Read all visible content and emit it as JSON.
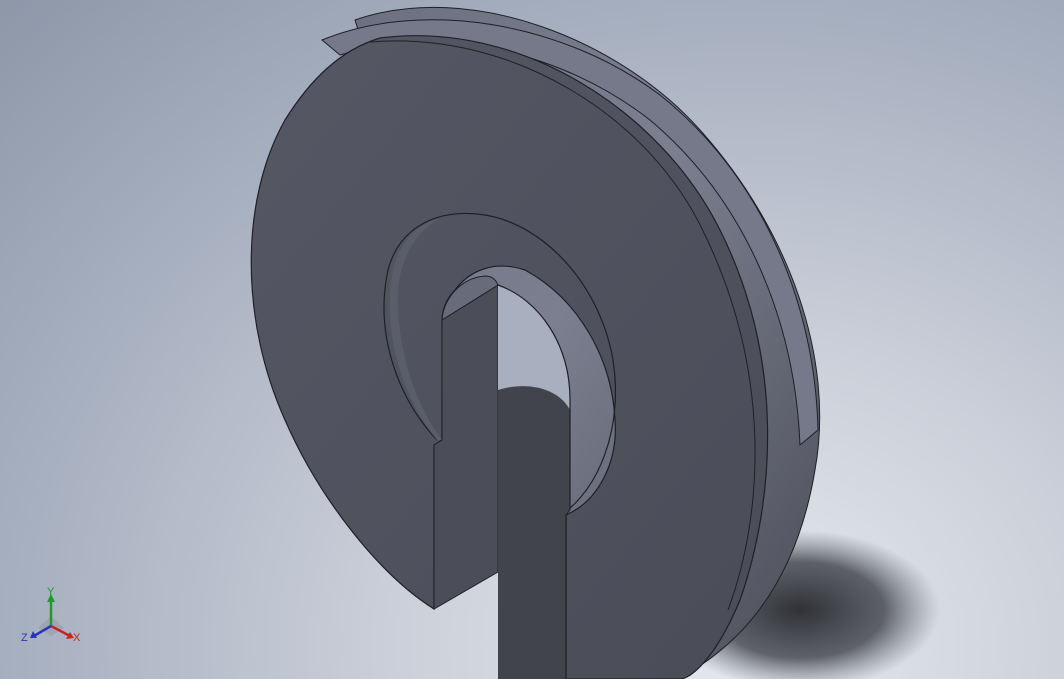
{
  "viewport": {
    "background_top": "#8d97a8",
    "background_bottom": "#e6e9ef",
    "model_face_color": "#4e505c",
    "model_rim_color": "#727585",
    "model_edge_color": "#1e2026",
    "shadow_color": "#2b2d33"
  },
  "triad": {
    "y_label": "Y",
    "x_label": "X",
    "z_label": "Z",
    "y_color": "#1e9a2a",
    "x_color": "#cc2222",
    "z_color": "#2a36b8"
  }
}
